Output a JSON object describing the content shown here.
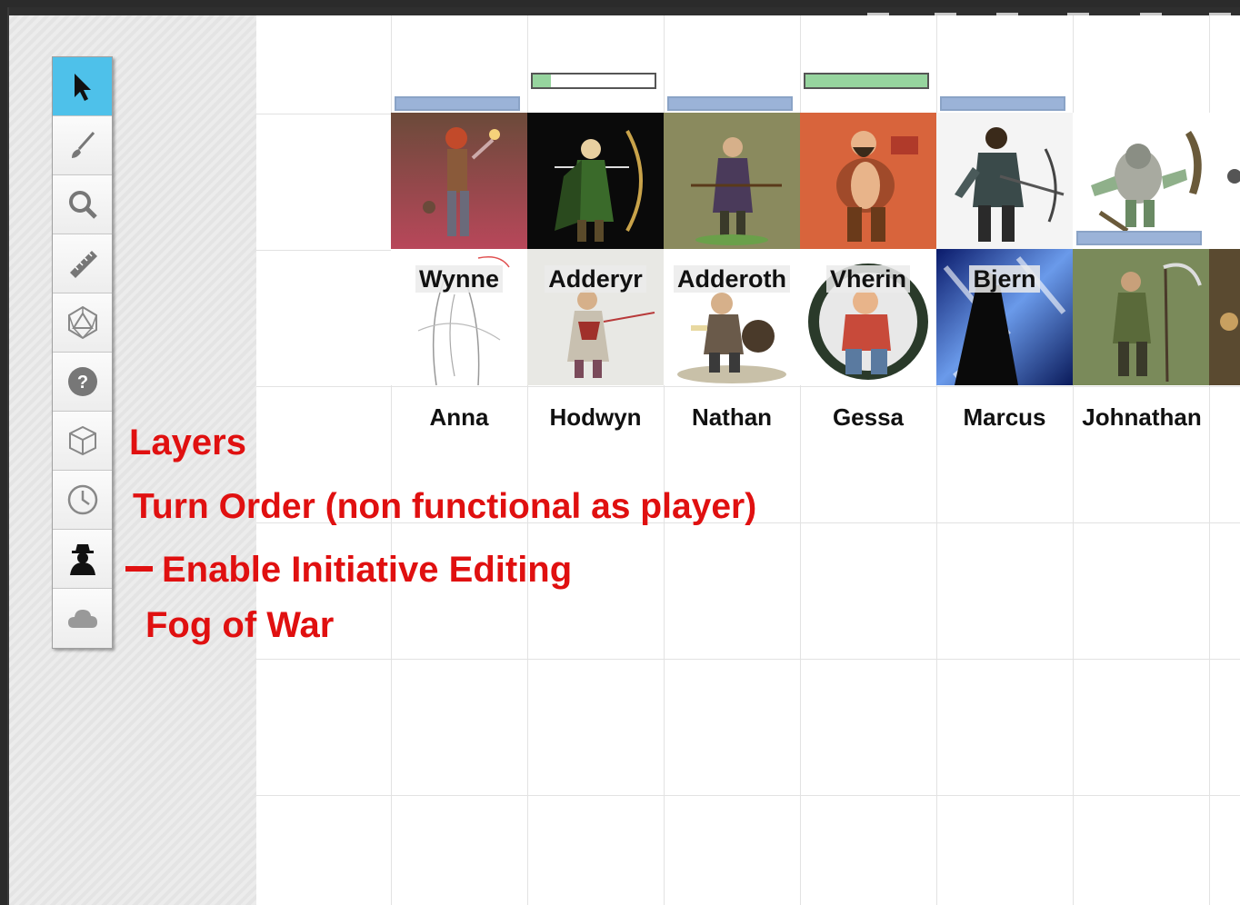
{
  "toolbar": {
    "tools": [
      {
        "name": "select-tool",
        "icon": "arrow-pointer-icon",
        "active": true
      },
      {
        "name": "draw-tool",
        "icon": "paintbrush-icon"
      },
      {
        "name": "zoom-tool",
        "icon": "magnifier-icon"
      },
      {
        "name": "measure-tool",
        "icon": "ruler-icon"
      },
      {
        "name": "dice-tool",
        "icon": "d20-icon"
      },
      {
        "name": "help-tool",
        "icon": "question-icon"
      },
      {
        "name": "layers-tool",
        "icon": "cube-icon"
      },
      {
        "name": "turn-order-tool",
        "icon": "clock-icon"
      },
      {
        "name": "gm-tool",
        "icon": "spy-icon"
      },
      {
        "name": "fog-tool",
        "icon": "cloud-icon"
      }
    ]
  },
  "annotations": {
    "layers": "Layers",
    "turn_order": "Turn Order (non functional as player)",
    "initiative": "Enable Initiative Editing",
    "fog": "Fog of War"
  },
  "tokens_row1": [
    {
      "name": "",
      "hp_fraction": null
    },
    {
      "name": "",
      "hp_fraction": 0.15
    },
    {
      "name": "",
      "hp_fraction": null
    },
    {
      "name": "",
      "hp_fraction": 1.0
    },
    {
      "name": "",
      "hp_fraction": null
    },
    {
      "name": "",
      "hp_fraction": null
    }
  ],
  "tokens_row2": [
    {
      "name": "Wynne"
    },
    {
      "name": "Adderyr"
    },
    {
      "name": "Adderoth"
    },
    {
      "name": "Vherin"
    },
    {
      "name": "Bjern"
    },
    {
      "name": ""
    }
  ],
  "players": [
    "Anna",
    "Hodwyn",
    "Nathan",
    "Gessa",
    "Marcus",
    "Johnathan"
  ],
  "colors": {
    "annotation": "#e01010",
    "active_tool": "#4ec1ea",
    "status_bar": "#9bb3d8",
    "hp_bar": "#96d49e"
  }
}
